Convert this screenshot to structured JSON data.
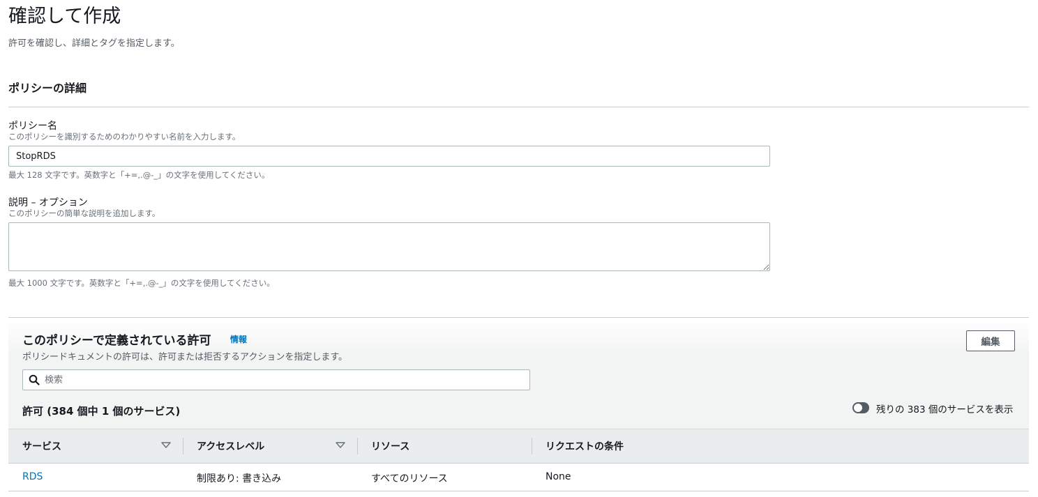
{
  "header": {
    "title": "確認して作成",
    "subtitle": "許可を確認し、詳細とタグを指定します。"
  },
  "policy_details": {
    "section_title": "ポリシーの詳細",
    "name_label": "ポリシー名",
    "name_description": "このポリシーを識別するためのわかりやすい名前を入力します。",
    "name_value": "StopRDS",
    "name_hint": "最大 128 文字です。英数字と「+=,.@-_」の文字を使用してください。",
    "description_label": "説明 – オプション",
    "description_description": "このポリシーの簡単な説明を追加します。",
    "description_value": "",
    "description_hint": "最大 1000 文字です。英数字と「+=,.@-_」の文字を使用してください。"
  },
  "permissions": {
    "title": "このポリシーで定義されている許可",
    "info_link": "情報",
    "description": "ポリシードキュメントの許可は、許可または拒否するアクションを指定します。",
    "edit_button": "編集",
    "search_placeholder": "検索",
    "count_title": "許可 (384 個中 1 個のサービス)",
    "toggle_label": "残りの 383 個のサービスを表示",
    "toggle_on": false,
    "columns": [
      "サービス",
      "アクセスレベル",
      "リソース",
      "リクエストの条件"
    ],
    "rows": [
      [
        "RDS",
        "制限あり: 書き込み",
        "すべてのリソース",
        "None"
      ]
    ]
  },
  "colors": {
    "link": "#0073bb",
    "panel_background": "#f2f3f3",
    "table_header": "#eaeded"
  },
  "icons": {
    "search": "search-icon",
    "sort": "caret-down-icon"
  }
}
